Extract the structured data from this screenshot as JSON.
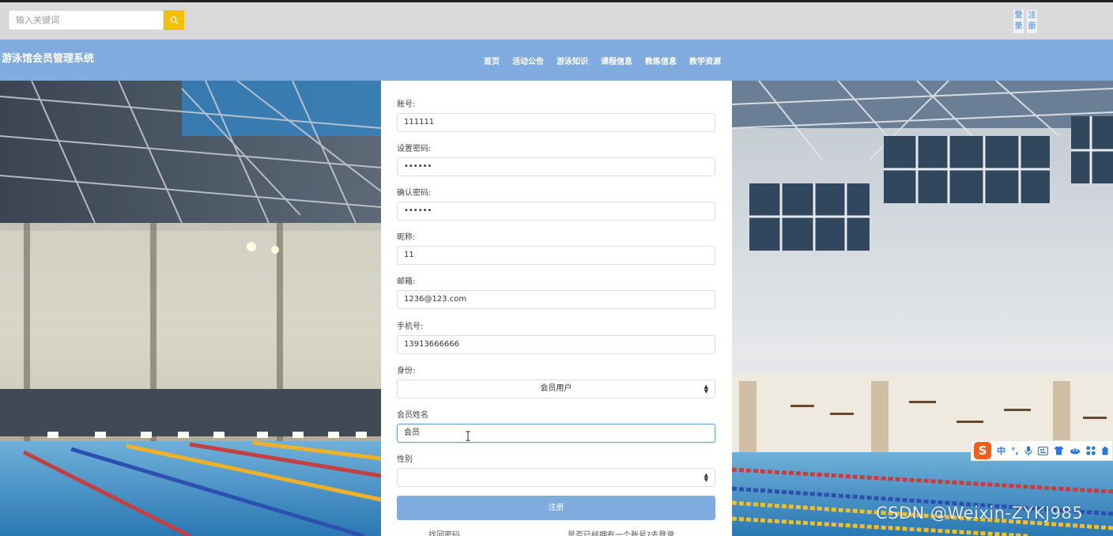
{
  "header": {
    "search": {
      "placeholder": "输入关键词"
    },
    "auth": {
      "login": "登录",
      "register": "注册"
    }
  },
  "navbar": {
    "brand": "游泳馆会员管理系统",
    "items": [
      "首页",
      "活动公告",
      "游泳知识",
      "课程信息",
      "教练信息",
      "教学资源"
    ]
  },
  "form": {
    "fields": [
      {
        "label": "账号:",
        "value": "111111"
      },
      {
        "label": "设置密码:",
        "value": "••••••"
      },
      {
        "label": "确认密码:",
        "value": "••••••"
      },
      {
        "label": "昵称:",
        "value": "11"
      },
      {
        "label": "邮箱:",
        "value": "1236@123.com"
      },
      {
        "label": "手机号:",
        "value": "13913666666"
      },
      {
        "label": "身份:",
        "value": "会员用户"
      },
      {
        "label": "会员姓名",
        "value": "会员"
      },
      {
        "label": "性别",
        "value": ""
      }
    ],
    "submit_label": "注册",
    "footer_left": "找回密码",
    "footer_right": "是否已经拥有一个账号?去登录"
  },
  "ime": {
    "mode": "中",
    "punct": "°,"
  },
  "watermark": "CSDN @Weixin-ZYKJ985",
  "colors": {
    "accent": "#7fabde",
    "search_button": "#f5c000",
    "ime_logo": "#f25d1c"
  }
}
